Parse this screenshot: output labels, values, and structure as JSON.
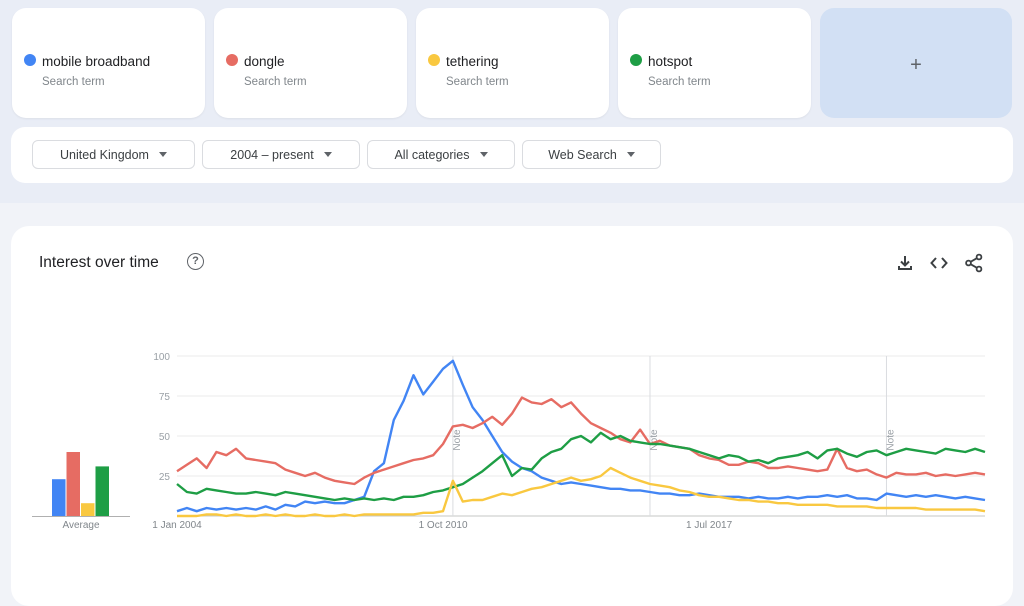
{
  "terms": [
    {
      "name": "mobile broadband",
      "sub": "Search term",
      "color": "#4285f4"
    },
    {
      "name": "dongle",
      "sub": "Search term",
      "color": "#e66c63"
    },
    {
      "name": "tethering",
      "sub": "Search term",
      "color": "#f9c840"
    },
    {
      "name": "hotspot",
      "sub": "Search term",
      "color": "#1e9e45"
    }
  ],
  "add_term": {
    "label": "+"
  },
  "filters": [
    {
      "label": "United Kingdom"
    },
    {
      "label": "2004 – present"
    },
    {
      "label": "All categories"
    },
    {
      "label": "Web Search"
    }
  ],
  "chart_card": {
    "title": "Interest over time",
    "help_icon": "?",
    "actions": [
      "download-icon",
      "embed-code-icon",
      "share-icon"
    ]
  },
  "chart_data": {
    "type": "line",
    "title": "Interest over time",
    "xlabel": "",
    "ylabel": "",
    "ylim": [
      0,
      100
    ],
    "yticks": [
      25,
      50,
      75,
      100
    ],
    "grid": true,
    "x_tick_labels": [
      {
        "label": "1 Jan 2004",
        "quarter_index": 0
      },
      {
        "label": "1 Oct 2010",
        "quarter_index": 27
      },
      {
        "label": "1 Jul 2017",
        "quarter_index": 54
      }
    ],
    "notes": [
      {
        "label": "Note",
        "quarter_index": 28
      },
      {
        "label": "Note",
        "quarter_index": 48
      },
      {
        "label": "Note",
        "quarter_index": 72
      }
    ],
    "x_granularity": "quarterly from Jan 2004",
    "series": [
      {
        "name": "mobile broadband",
        "color": "#4285f4",
        "values": [
          3,
          5,
          3,
          5,
          4,
          5,
          4,
          5,
          4,
          6,
          4,
          7,
          6,
          9,
          8,
          9,
          8,
          8,
          10,
          12,
          28,
          33,
          60,
          72,
          88,
          76,
          84,
          92,
          97,
          82,
          68,
          60,
          50,
          40,
          34,
          30,
          28,
          24,
          22,
          20,
          21,
          20,
          19,
          18,
          17,
          17,
          16,
          16,
          15,
          14,
          14,
          13,
          13,
          14,
          13,
          12,
          12,
          12,
          11,
          12,
          11,
          11,
          12,
          11,
          12,
          12,
          13,
          12,
          13,
          11,
          11,
          10,
          14,
          13,
          12,
          13,
          12,
          13,
          12,
          11,
          12,
          11,
          10
        ]
      },
      {
        "name": "dongle",
        "color": "#e66c63",
        "values": [
          28,
          32,
          36,
          30,
          40,
          38,
          42,
          36,
          35,
          34,
          33,
          29,
          27,
          25,
          27,
          24,
          22,
          21,
          20,
          24,
          27,
          29,
          31,
          33,
          35,
          36,
          38,
          45,
          56,
          57,
          55,
          58,
          62,
          57,
          64,
          74,
          71,
          70,
          73,
          68,
          71,
          64,
          58,
          55,
          52,
          48,
          46,
          54,
          45,
          47,
          44,
          43,
          42,
          38,
          36,
          35,
          32,
          32,
          34,
          33,
          30,
          30,
          31,
          30,
          29,
          28,
          29,
          42,
          30,
          28,
          29,
          26,
          24,
          27,
          26,
          26,
          27,
          25,
          26,
          25,
          26,
          27,
          26
        ]
      },
      {
        "name": "hotspot",
        "color": "#1e9e45",
        "values": [
          20,
          15,
          14,
          17,
          16,
          15,
          14,
          14,
          15,
          14,
          13,
          15,
          14,
          13,
          12,
          11,
          10,
          11,
          10,
          11,
          10,
          11,
          10,
          12,
          12,
          13,
          15,
          16,
          18,
          20,
          24,
          28,
          33,
          38,
          25,
          30,
          29,
          36,
          40,
          42,
          48,
          50,
          46,
          52,
          48,
          50,
          47,
          46,
          45,
          45,
          44,
          43,
          42,
          40,
          38,
          36,
          38,
          37,
          34,
          35,
          33,
          36,
          37,
          38,
          40,
          36,
          41,
          42,
          39,
          37,
          40,
          41,
          38,
          40,
          42,
          41,
          40,
          39,
          42,
          41,
          40,
          42,
          40
        ]
      },
      {
        "name": "tethering",
        "color": "#f9c840",
        "values": [
          0,
          0,
          0,
          1,
          1,
          0,
          1,
          0,
          0,
          1,
          0,
          1,
          0,
          0,
          1,
          0,
          0,
          1,
          0,
          1,
          1,
          1,
          1,
          1,
          1,
          2,
          2,
          3,
          22,
          9,
          10,
          10,
          12,
          14,
          13,
          15,
          17,
          18,
          20,
          22,
          24,
          22,
          23,
          25,
          30,
          27,
          24,
          22,
          20,
          19,
          18,
          16,
          15,
          13,
          12,
          12,
          11,
          10,
          10,
          9,
          9,
          8,
          8,
          7,
          7,
          7,
          7,
          6,
          6,
          6,
          6,
          5,
          5,
          5,
          5,
          5,
          4,
          4,
          4,
          4,
          4,
          4,
          3
        ]
      }
    ],
    "average": {
      "label": "Average",
      "values": [
        {
          "name": "mobile broadband",
          "value": 23,
          "color": "#4285f4"
        },
        {
          "name": "dongle",
          "value": 40,
          "color": "#e66c63"
        },
        {
          "name": "tethering",
          "value": 8,
          "color": "#f9c840"
        },
        {
          "name": "hotspot",
          "value": 31,
          "color": "#1e9e45"
        }
      ]
    }
  }
}
